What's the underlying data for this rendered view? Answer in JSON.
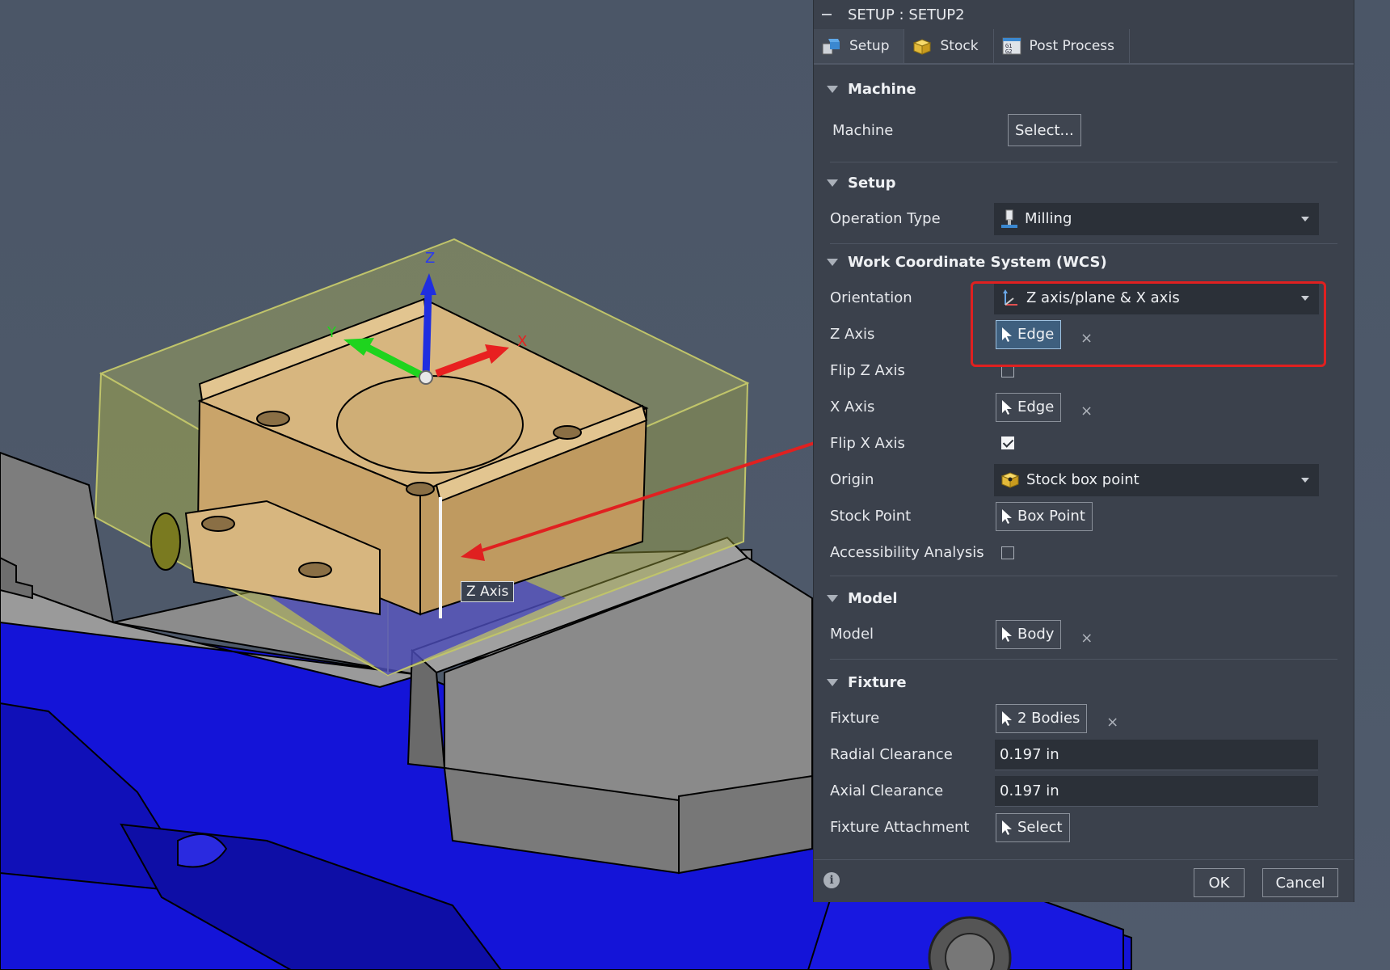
{
  "panel": {
    "title": "SETUP : SETUP2",
    "tabs": [
      {
        "label": "Setup",
        "icon": "setup-icon"
      },
      {
        "label": "Stock",
        "icon": "stock-cube-icon"
      },
      {
        "label": "Post Process",
        "icon": "gcode-icon"
      }
    ],
    "sections": {
      "machine": {
        "title": "Machine",
        "machine_label": "Machine",
        "machine_button": "Select..."
      },
      "setup": {
        "title": "Setup",
        "operation_type_label": "Operation Type",
        "operation_type_value": "Milling"
      },
      "wcs": {
        "title": "Work Coordinate System (WCS)",
        "orientation_label": "Orientation",
        "orientation_value": "Z axis/plane & X axis",
        "z_axis_label": "Z Axis",
        "z_axis_value": "Edge",
        "flip_z_label": "Flip Z Axis",
        "flip_z_checked": false,
        "x_axis_label": "X Axis",
        "x_axis_value": "Edge",
        "flip_x_label": "Flip X Axis",
        "flip_x_checked": true,
        "origin_label": "Origin",
        "origin_value": "Stock box point",
        "stock_point_label": "Stock Point",
        "stock_point_value": "Box Point",
        "accessibility_label": "Accessibility Analysis",
        "accessibility_checked": false
      },
      "model": {
        "title": "Model",
        "model_label": "Model",
        "model_value": "Body"
      },
      "fixture": {
        "title": "Fixture",
        "fixture_label": "Fixture",
        "fixture_value": "2 Bodies",
        "radial_label": "Radial Clearance",
        "radial_value": "0.197 in",
        "axial_label": "Axial Clearance",
        "axial_value": "0.197 in",
        "attachment_label": "Fixture Attachment",
        "attachment_value": "Select"
      }
    },
    "clear_symbol": "×",
    "footer": {
      "info": "i",
      "ok": "OK",
      "cancel": "Cancel"
    }
  },
  "viewport": {
    "tooltip": "Z Axis",
    "triad": {
      "x": "X",
      "y": "Y",
      "z": "Z"
    }
  },
  "colors": {
    "panel_bg": "#3b414c",
    "highlight": "#e02020",
    "vise_blue": "#1414d8",
    "part_tan": "#d4b27a",
    "stock_box": "#c8cc5a"
  }
}
